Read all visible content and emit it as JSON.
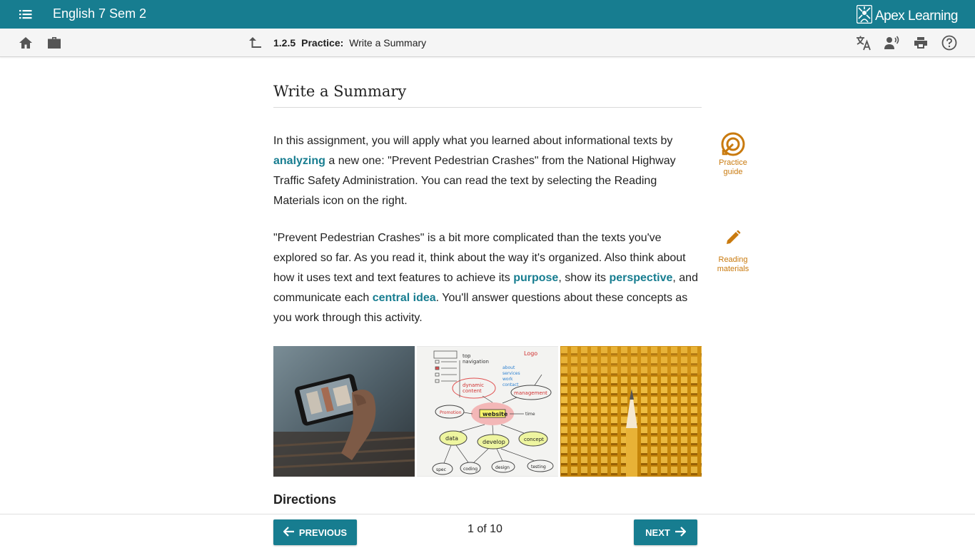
{
  "app": {
    "course_title": "English 7 Sem 2",
    "brand": "Apex Learning",
    "accent_color": "#177d90",
    "tool_color": "#c97a0e"
  },
  "breadcrumb": {
    "number": "1.2.5",
    "kind": "Practice:",
    "title": "Write a Summary"
  },
  "toolbar_icons": [
    "home-icon",
    "briefcase-icon",
    "up-arrow-icon",
    "translate-icon",
    "text-to-speech-icon",
    "print-icon",
    "help-icon"
  ],
  "main": {
    "title": "Write a Summary",
    "para1": {
      "t1": "In this assignment, you will apply what you learned about informational texts by ",
      "k1": "analyzing",
      "t2": " a new one: \"Prevent Pedestrian Crashes\" from the National Highway Traffic Safety Administration. You can read the text by selecting the Reading Materials icon on the right."
    },
    "para2": {
      "t1": "\"Prevent Pedestrian Crashes\" is a bit more complicated than the texts you've explored so far. As you read it, think about the way it's organized. Also think about how it uses text and text features to achieve its ",
      "k1": "purpose",
      "t2": ", show its ",
      "k2": "perspective",
      "t3": ", and communicate each ",
      "k3": "central idea",
      "t4": ". You'll answer questions about these concepts as you work through this activity."
    },
    "directions_heading": "Directions"
  },
  "side_tools": {
    "practice_guide": {
      "line1": "Practice",
      "line2": "guide"
    },
    "reading_materials": {
      "line1": "Reading",
      "line2": "materials"
    }
  },
  "diagram_words": {
    "website": "website",
    "management": "management",
    "dynamic": "dynamic",
    "content": "content",
    "promotion": "Promotion",
    "data": "data",
    "develop": "develop",
    "concept": "concept",
    "spec": "spec",
    "coding": "coding",
    "design": "design",
    "testing": "testing",
    "time": "time",
    "top_navigation": "top navigation",
    "logo": "Logo",
    "about": "about",
    "services": "services",
    "work": "work",
    "contact": "contact"
  },
  "footer": {
    "previous": "PREVIOUS",
    "next": "NEXT",
    "page_count": "1 of 10"
  }
}
